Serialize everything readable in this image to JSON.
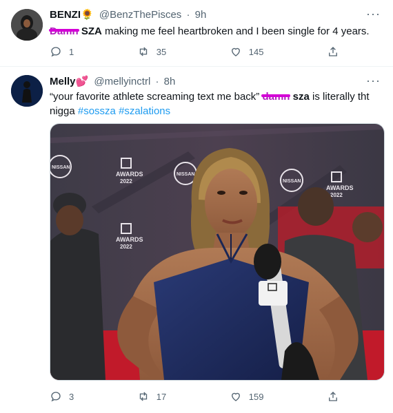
{
  "tweets": [
    {
      "name": "BENZI",
      "name_emoji": "🌻",
      "handle": "@BenzThePisces",
      "time": "9h",
      "scribbled_word": "Damn",
      "text_bold": "SZA",
      "text_rest": " making me feel heartbroken and I been single for 4 years.",
      "replies": "1",
      "retweets": "35",
      "likes": "145"
    },
    {
      "name": "Melly",
      "name_emoji": "💕",
      "handle": "@mellyinctrl",
      "time": "8h",
      "text_pre": "“your favorite athlete screaming text me back” ",
      "scribbled_word": "damn",
      "text_bold": " sza",
      "text_mid": " is literally tht",
      "text_line2": "nigga ",
      "hashtag1": "#sossza",
      "hashtag2": "#szalations",
      "media_text_awards": "AWARDS",
      "media_text_year": "2022",
      "media_text_nissan": "NISSAN",
      "replies": "3",
      "retweets": "17",
      "likes": "159"
    }
  ],
  "colors": {
    "accent": "#1d9bf0",
    "muted": "#536471",
    "scribble": "#d400d6",
    "backdrop": "#4a3f4a",
    "dress": "#1c2a5a"
  }
}
